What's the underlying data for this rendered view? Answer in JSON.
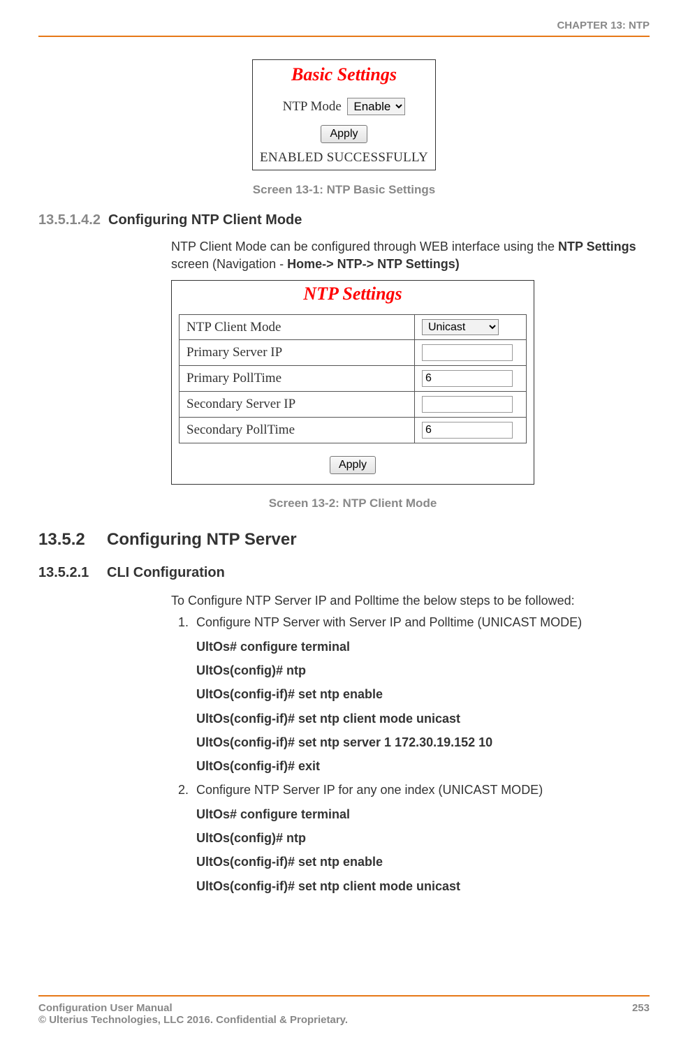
{
  "header": {
    "chapter": "CHAPTER 13: NTP"
  },
  "fig1": {
    "title": "Basic Settings",
    "mode_label": "NTP Mode",
    "mode_value": "Enable",
    "apply": "Apply",
    "status": "ENABLED SUCCESSFULLY",
    "caption": "Screen 13-1: NTP Basic Settings"
  },
  "sec_client": {
    "num": "13.5.1.4.2",
    "title": "Configuring NTP Client Mode",
    "para_pre": "NTP Client Mode can be configured through WEB interface using the ",
    "para_bold1": "NTP Settings",
    "para_mid": " screen (Navigation - ",
    "para_bold2": "Home-> NTP-> NTP Settings)"
  },
  "fig2": {
    "title": "NTP Settings",
    "rows": {
      "client_mode_lbl": "NTP Client Mode",
      "client_mode_val": "Unicast",
      "primary_ip_lbl": "Primary Server IP",
      "primary_ip_val": "",
      "primary_poll_lbl": "Primary PollTime",
      "primary_poll_val": "6",
      "secondary_ip_lbl": "Secondary Server IP",
      "secondary_ip_val": "",
      "secondary_poll_lbl": "Secondary PollTime",
      "secondary_poll_val": "6"
    },
    "apply": "Apply",
    "caption": "Screen 13-2: NTP Client Mode"
  },
  "h2": {
    "num": "13.5.2",
    "title": "Configuring NTP Server"
  },
  "h3": {
    "num": "13.5.2.1",
    "title": "CLI Configuration"
  },
  "cli": {
    "intro": "To Configure NTP Server IP and Polltime the below steps to be followed:",
    "step1_text": "Configure NTP Server with Server IP and Polltime (UNICAST MODE)",
    "step1_cmds": {
      "c1": "UltOs# configure terminal",
      "c2": "UltOs(config)# ntp",
      "c3": "UltOs(config-if)# set ntp enable",
      "c4": "UltOs(config-if)# set ntp client mode unicast",
      "c5": "UltOs(config-if)# set ntp server 1 172.30.19.152 10",
      "c6": "UltOs(config-if)# exit"
    },
    "step2_text": "Configure NTP Server IP for any one index (UNICAST MODE)",
    "step2_cmds": {
      "c1": "UltOs# configure terminal",
      "c2": "UltOs(config)# ntp",
      "c3": "UltOs(config-if)# set ntp enable",
      "c4": "UltOs(config-if)# set ntp client mode unicast"
    }
  },
  "footer": {
    "left1": "Configuration User Manual",
    "left2": "© Ulterius Technologies, LLC 2016. Confidential & Proprietary.",
    "page": "253"
  }
}
